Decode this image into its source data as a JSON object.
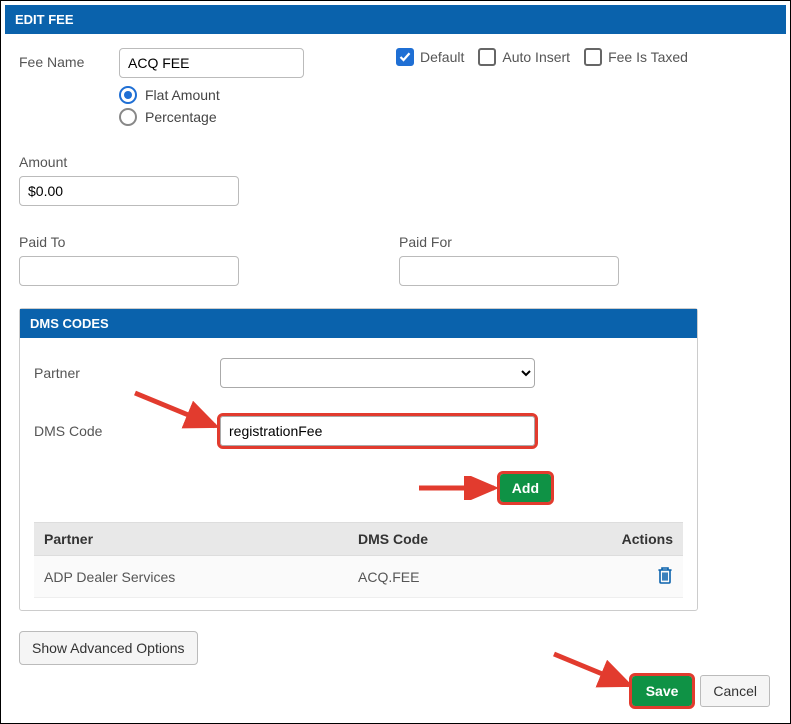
{
  "header": {
    "title": "EDIT FEE"
  },
  "fee": {
    "name_label": "Fee Name",
    "name_value": "ACQ FEE",
    "checks": {
      "default_label": "Default",
      "default_checked": true,
      "auto_label": "Auto Insert",
      "auto_checked": false,
      "taxed_label": "Fee Is Taxed",
      "taxed_checked": false
    },
    "type": {
      "flat_label": "Flat Amount",
      "percentage_label": "Percentage",
      "selected": "flat"
    },
    "amount_label": "Amount",
    "amount_value": "$0.00",
    "paid_to_label": "Paid To",
    "paid_to_value": "",
    "paid_for_label": "Paid For",
    "paid_for_value": ""
  },
  "dms": {
    "title": "DMS CODES",
    "partner_label": "Partner",
    "partner_value": "",
    "code_label": "DMS Code",
    "code_value": "registrationFee",
    "add_label": "Add",
    "columns": {
      "partner": "Partner",
      "code": "DMS Code",
      "actions": "Actions"
    },
    "rows": [
      {
        "partner": "ADP Dealer Services",
        "code": "ACQ.FEE"
      }
    ]
  },
  "advanced_label": "Show Advanced Options",
  "buttons": {
    "save": "Save",
    "cancel": "Cancel"
  }
}
